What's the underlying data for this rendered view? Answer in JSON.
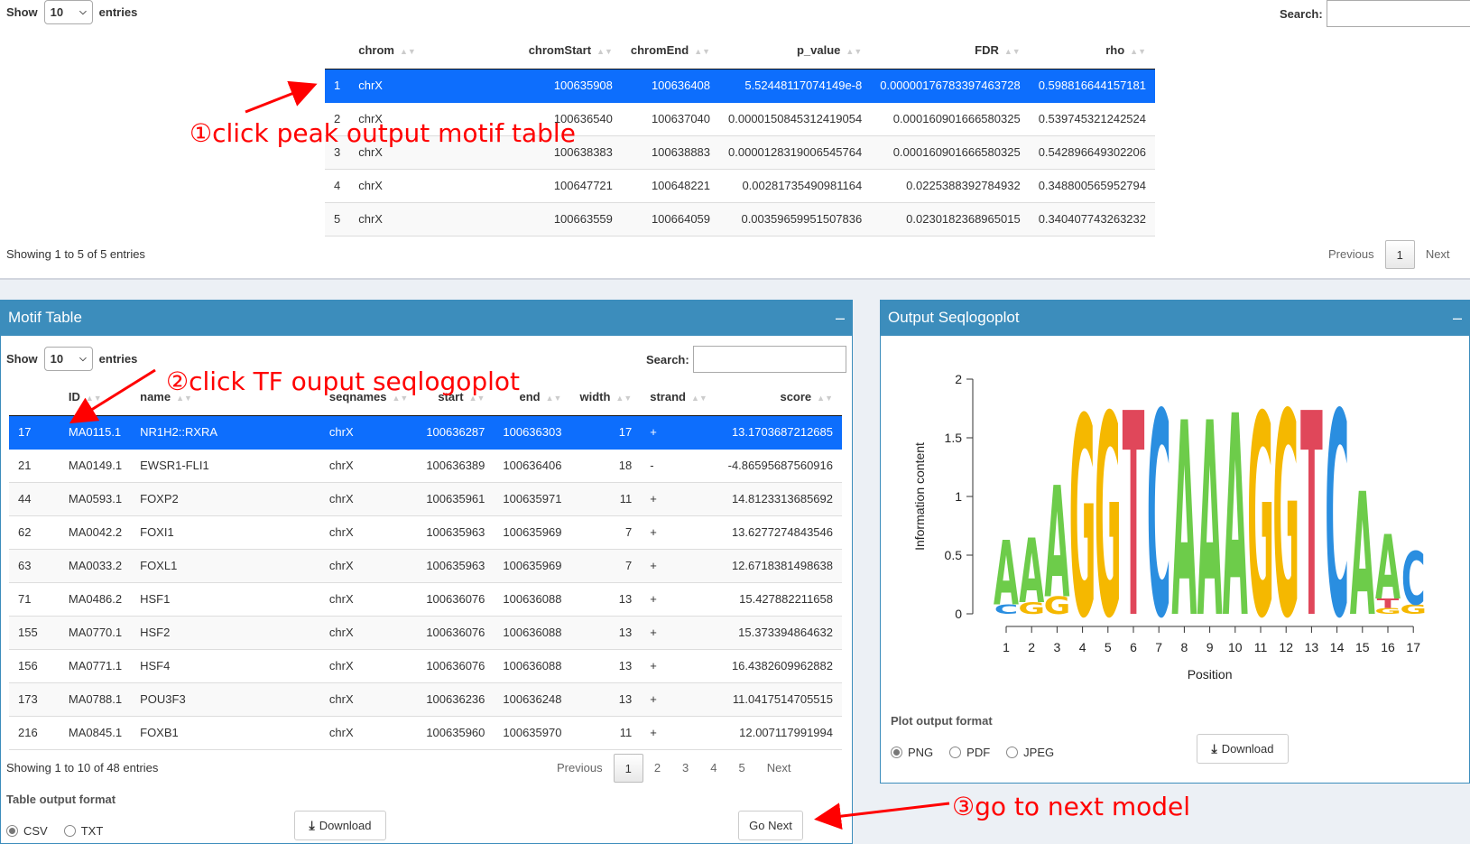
{
  "peak_table": {
    "length_label_show": "Show",
    "length_value": "10",
    "length_label_entries": "entries",
    "search_label": "Search:",
    "columns": [
      "",
      "chrom",
      "chromStart",
      "chromEnd",
      "p_value",
      "FDR",
      "rho"
    ],
    "rows": [
      [
        "1",
        "chrX",
        "100635908",
        "100636408",
        "5.52448117074149e-8",
        "0.00000176783397463728",
        "0.598816644157181"
      ],
      [
        "2",
        "chrX",
        "100636540",
        "100637040",
        "0.0000150845312419054",
        "0.000160901666580325",
        "0.539745321242524"
      ],
      [
        "3",
        "chrX",
        "100638383",
        "100638883",
        "0.0000128319006545764",
        "0.000160901666580325",
        "0.542896649302206"
      ],
      [
        "4",
        "chrX",
        "100647721",
        "100648221",
        "0.00281735490981164",
        "0.0225388392784932",
        "0.348800565952794"
      ],
      [
        "5",
        "chrX",
        "100663559",
        "100664059",
        "0.00359659951507836",
        "0.0230182368965015",
        "0.340407743263232"
      ]
    ],
    "selected_row": 0,
    "info": "Showing 1 to 5 of 5 entries",
    "pager": {
      "previous": "Previous",
      "pages": [
        "1"
      ],
      "next": "Next"
    }
  },
  "motif_box": {
    "title": "Motif Table",
    "collapse_icon": "minus-icon",
    "length_label_show": "Show",
    "length_value": "10",
    "length_label_entries": "entries",
    "search_label": "Search:",
    "columns": [
      "",
      "ID",
      "name",
      "seqnames",
      "start",
      "end",
      "width",
      "strand",
      "score"
    ],
    "rows": [
      [
        "17",
        "MA0115.1",
        "NR1H2::RXRA",
        "chrX",
        "100636287",
        "100636303",
        "17",
        "+",
        "13.1703687212685"
      ],
      [
        "21",
        "MA0149.1",
        "EWSR1-FLI1",
        "chrX",
        "100636389",
        "100636406",
        "18",
        "-",
        "-4.86595687560916"
      ],
      [
        "44",
        "MA0593.1",
        "FOXP2",
        "chrX",
        "100635961",
        "100635971",
        "11",
        "+",
        "14.8123313685692"
      ],
      [
        "62",
        "MA0042.2",
        "FOXI1",
        "chrX",
        "100635963",
        "100635969",
        "7",
        "+",
        "13.6277274843546"
      ],
      [
        "63",
        "MA0033.2",
        "FOXL1",
        "chrX",
        "100635963",
        "100635969",
        "7",
        "+",
        "12.6718381498638"
      ],
      [
        "71",
        "MA0486.2",
        "HSF1",
        "chrX",
        "100636076",
        "100636088",
        "13",
        "+",
        "15.427882211658"
      ],
      [
        "155",
        "MA0770.1",
        "HSF2",
        "chrX",
        "100636076",
        "100636088",
        "13",
        "+",
        "15.373394864632"
      ],
      [
        "156",
        "MA0771.1",
        "HSF4",
        "chrX",
        "100636076",
        "100636088",
        "13",
        "+",
        "16.4382609962882"
      ],
      [
        "173",
        "MA0788.1",
        "POU3F3",
        "chrX",
        "100636236",
        "100636248",
        "13",
        "+",
        "11.0417514705515"
      ],
      [
        "216",
        "MA0845.1",
        "FOXB1",
        "chrX",
        "100635960",
        "100635970",
        "11",
        "+",
        "12.007117991994"
      ]
    ],
    "selected_row": 0,
    "info": "Showing 1 to 10 of 48 entries",
    "pager": {
      "previous": "Previous",
      "pages": [
        "1",
        "2",
        "3",
        "4",
        "5"
      ],
      "next": "Next"
    },
    "format_title": "Table output format",
    "formats": [
      "CSV",
      "TXT"
    ],
    "format_selected": "CSV",
    "download_label": "Download",
    "go_next_label": "Go Next"
  },
  "seqlogo_box": {
    "title": "Output Seqlogoplot",
    "collapse_icon": "minus-icon",
    "ylabel": "Information content",
    "xlabel": "Position",
    "yticks": [
      "0",
      "0.5",
      "1",
      "1.5",
      "2"
    ],
    "positions": [
      "1",
      "2",
      "3",
      "4",
      "5",
      "6",
      "7",
      "8",
      "9",
      "10",
      "11",
      "12",
      "13",
      "14",
      "15",
      "16",
      "17"
    ],
    "format_title": "Plot output format",
    "formats": [
      "PNG",
      "PDF",
      "JPEG"
    ],
    "format_selected": "PNG",
    "download_label": "Download"
  },
  "chart_data": {
    "type": "seqlogo",
    "xlabel": "Position",
    "ylabel": "Information content",
    "ylim": [
      0,
      2
    ],
    "colors": {
      "A": "#6dcc4a",
      "C": "#2a8ee0",
      "G": "#f5b800",
      "T": "#e0475a"
    },
    "columns": [
      {
        "pos": 1,
        "stack": [
          [
            "C",
            0.08
          ],
          [
            "A",
            0.55
          ]
        ]
      },
      {
        "pos": 2,
        "stack": [
          [
            "G",
            0.1
          ],
          [
            "A",
            0.55
          ]
        ]
      },
      {
        "pos": 3,
        "stack": [
          [
            "G",
            0.15
          ],
          [
            "A",
            0.95
          ]
        ]
      },
      {
        "pos": 4,
        "stack": [
          [
            "G",
            1.7
          ]
        ]
      },
      {
        "pos": 5,
        "stack": [
          [
            "G",
            1.72
          ]
        ]
      },
      {
        "pos": 6,
        "stack": [
          [
            "T",
            1.74
          ]
        ]
      },
      {
        "pos": 7,
        "stack": [
          [
            "C",
            1.74
          ]
        ]
      },
      {
        "pos": 8,
        "stack": [
          [
            "A",
            1.66
          ]
        ]
      },
      {
        "pos": 9,
        "stack": [
          [
            "A",
            1.66
          ]
        ]
      },
      {
        "pos": 10,
        "stack": [
          [
            "A",
            1.72
          ]
        ]
      },
      {
        "pos": 11,
        "stack": [
          [
            "G",
            1.72
          ]
        ]
      },
      {
        "pos": 12,
        "stack": [
          [
            "G",
            1.74
          ]
        ]
      },
      {
        "pos": 13,
        "stack": [
          [
            "T",
            1.74
          ]
        ]
      },
      {
        "pos": 14,
        "stack": [
          [
            "C",
            1.74
          ]
        ]
      },
      {
        "pos": 15,
        "stack": [
          [
            "A",
            1.05
          ]
        ]
      },
      {
        "pos": 16,
        "stack": [
          [
            "G",
            0.05
          ],
          [
            "T",
            0.08
          ],
          [
            "A",
            0.55
          ]
        ]
      },
      {
        "pos": 17,
        "stack": [
          [
            "G",
            0.08
          ],
          [
            "C",
            0.45
          ]
        ]
      }
    ]
  },
  "annotations": [
    {
      "text": "①click peak output motif table"
    },
    {
      "text": "②click TF ouput seqlogoplot"
    },
    {
      "text": "③go to next model"
    }
  ]
}
